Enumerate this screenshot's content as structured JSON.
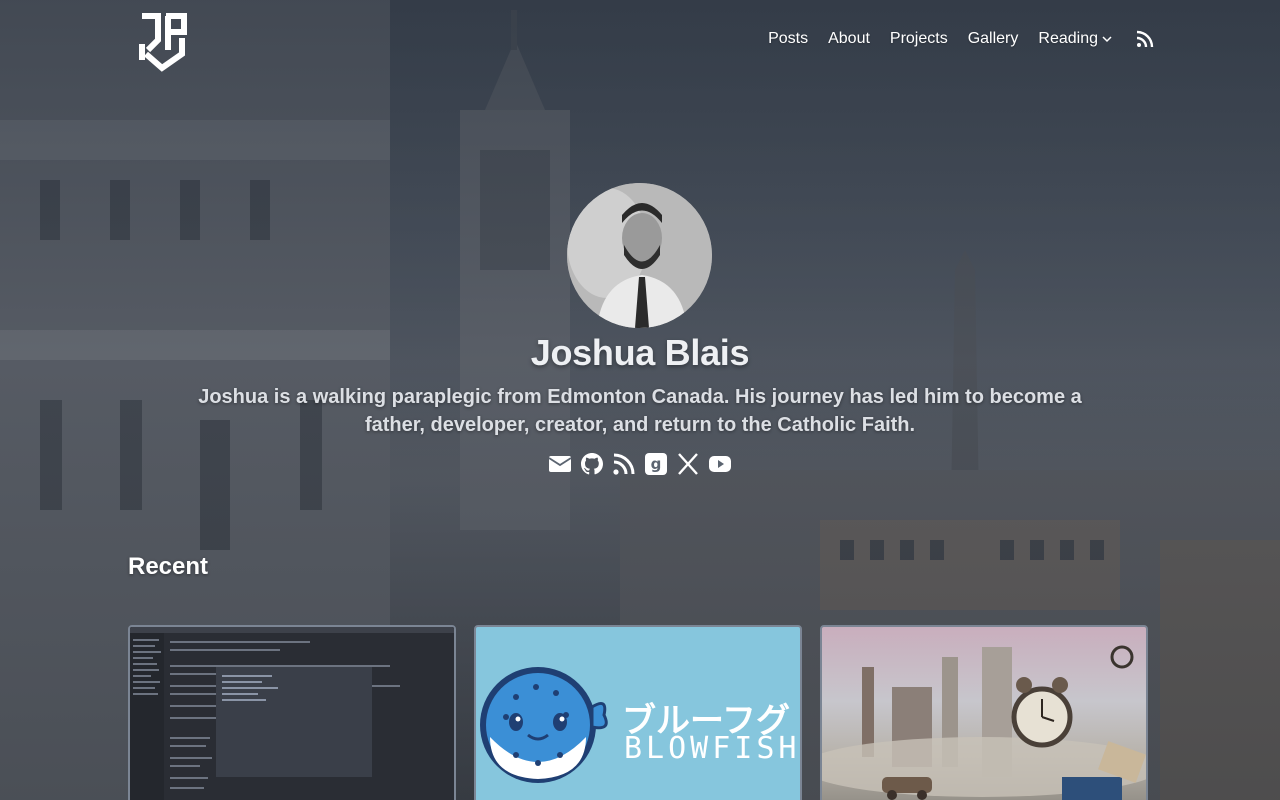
{
  "nav": {
    "items": [
      {
        "label": "Posts"
      },
      {
        "label": "About"
      },
      {
        "label": "Projects"
      },
      {
        "label": "Gallery"
      },
      {
        "label": "Reading"
      }
    ]
  },
  "hero": {
    "name": "Joshua Blais",
    "bio": "Joshua is a walking paraplegic from Edmonton Canada. His journey has led him to become a father, developer, creator, and return to the Catholic Faith.",
    "socials": [
      "email-icon",
      "github-icon",
      "rss-icon",
      "goodreads-icon",
      "x-icon",
      "youtube-icon"
    ]
  },
  "recent": {
    "title": "Recent",
    "cards": [
      {
        "image": "terminal-screenshot"
      },
      {
        "image": "blowfish-logo",
        "jp_text": "ブルーフグ",
        "en_text": "BLOWFISH"
      },
      {
        "image": "surreal-clock-city"
      }
    ]
  },
  "colors": {
    "text": "#ffffff",
    "card_blue": "#86c6dd",
    "card_border": "#7b8594"
  }
}
